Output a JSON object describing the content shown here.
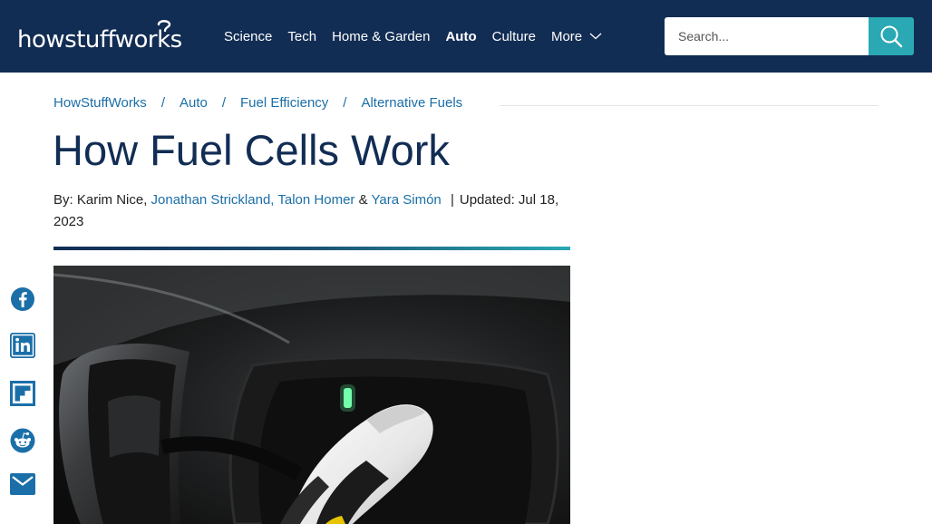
{
  "site": {
    "logo_text": "howstuffworks"
  },
  "nav": {
    "items": [
      {
        "label": "Science",
        "active": false
      },
      {
        "label": "Tech",
        "active": false
      },
      {
        "label": "Home & Garden",
        "active": false
      },
      {
        "label": "Auto",
        "active": true
      },
      {
        "label": "Culture",
        "active": false
      }
    ],
    "more_label": "More",
    "more_icon": "chevron-down-icon"
  },
  "search": {
    "placeholder": "Search...",
    "button_icon": "search-icon"
  },
  "breadcrumb": [
    "HowStuffWorks",
    "Auto",
    "Fuel Efficiency",
    "Alternative Fuels"
  ],
  "breadcrumb_separator": "/",
  "article": {
    "title": "How Fuel Cells Work",
    "byline_prefix": "By:",
    "author_plain": "Karim Nice,",
    "author_links": [
      "Jonathan Strickland,",
      "Talon Homer"
    ],
    "ampersand": "&",
    "author_last": "Yara Simón",
    "pipe": "|",
    "updated_label": "Updated:",
    "updated_date": "Jul 18, 2023"
  },
  "share": [
    {
      "icon": "facebook-icon",
      "color": "#1b6fa8"
    },
    {
      "icon": "linkedin-icon",
      "color": "#1b6fa8"
    },
    {
      "icon": "flipboard-icon",
      "color": "#1b6fa8"
    },
    {
      "icon": "reddit-icon",
      "color": "#1b6fa8"
    },
    {
      "icon": "email-icon",
      "color": "#1b6fa8"
    }
  ],
  "colors": {
    "header_bg": "#122d54",
    "accent": "#2aa8b4",
    "link": "#1b6fa8"
  }
}
